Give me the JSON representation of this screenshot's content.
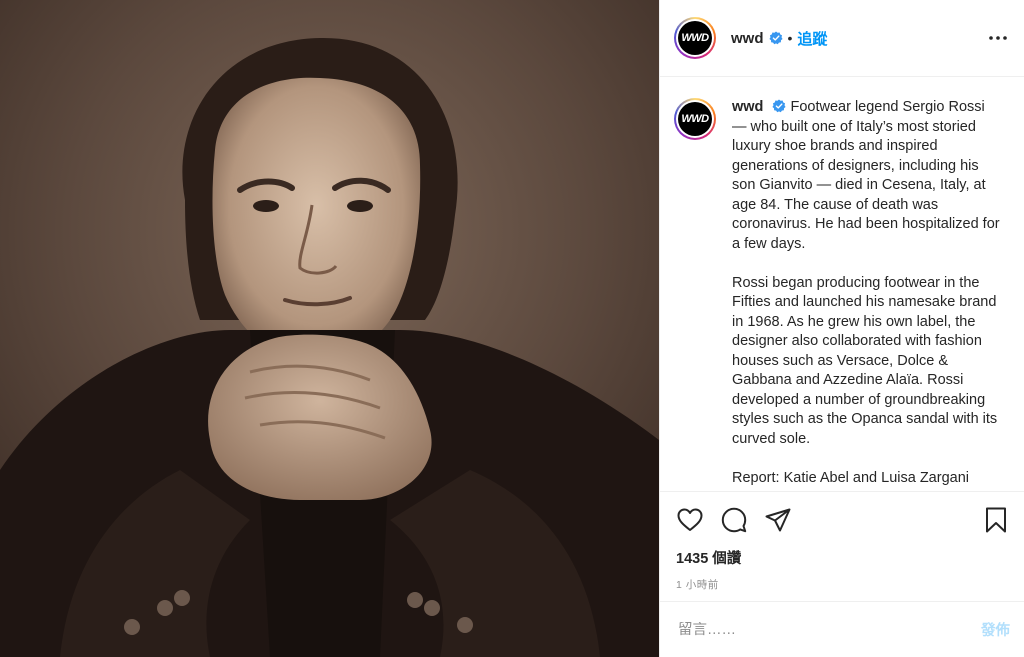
{
  "post": {
    "image_icon": "portrait-photo",
    "author": {
      "username": "wwd",
      "avatar_text": "WWD",
      "verified_icon": "verified-badge-icon",
      "separator": "•",
      "follow_label": "追蹤"
    },
    "more_icon": "more-options-icon",
    "caption": {
      "username": "wwd",
      "paragraphs": [
        "Footwear legend Sergio Rossi — who built one of Italy’s most storied luxury shoe brands and inspired generations of designers, including his son Gianvito — died in Cesena, Italy, at age 84. The cause of death was coronavirus. He had been hospitalized for a few days.",
        "Rossi began producing footwear in the Fifties and launched his namesake brand in 1968. As he grew his own label, the designer also collaborated with fashion houses such as Versace, Dolce & Gabbana and Azzedine Alaïa. Rossi developed a number of groundbreaking styles such as the Opanca sandal with its curved sole.",
        "Report: Katie Abel and Luisa Zargani"
      ]
    },
    "actions": {
      "like_icon": "heart-icon",
      "comment_icon": "comment-icon",
      "share_icon": "share-icon",
      "save_icon": "bookmark-icon"
    },
    "views": "1435 個讚",
    "timestamp": "1 小時前",
    "comment_box": {
      "placeholder": "留言……",
      "post_label": "發佈"
    }
  },
  "colors": {
    "accent": "#0095f6",
    "post_disabled": "#b2dffc",
    "muted": "#8e8e8e",
    "border": "#efefef"
  }
}
